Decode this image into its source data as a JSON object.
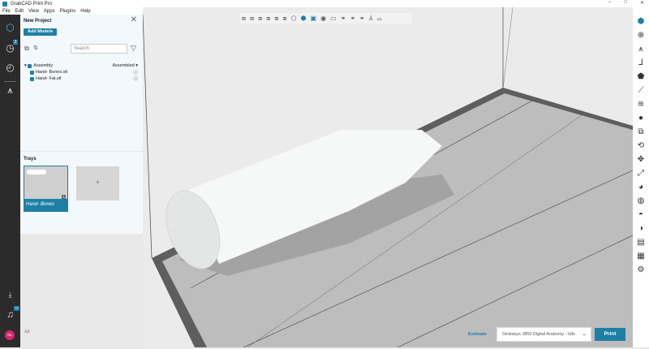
{
  "app": {
    "title": "GrabCAD Print Pro",
    "window_controls": [
      "–",
      "□",
      "✕"
    ]
  },
  "menu": [
    "File",
    "Edit",
    "View",
    "Apps",
    "Plugins",
    "Help"
  ],
  "leftbar": {
    "badge_recent": "2",
    "badge_notif": "9+",
    "avatar": "GL"
  },
  "panel": {
    "title": "New Project",
    "add_models": "Add Models",
    "search_placeholder": "Search",
    "tree": {
      "assembly": "Assembly",
      "mode": "Assembled",
      "items": [
        "Hand- Bones.stl",
        "Hand- Fat.stl"
      ]
    }
  },
  "trays": {
    "title": "Trays",
    "tray_name": "Hand- Bones",
    "count": "1"
  },
  "bottom": {
    "estimate": "Estimate",
    "printer": "Stratasys J850 Digital Anatomy - Idle",
    "print": "Print"
  },
  "colors": {
    "accent": "#1e7fa6",
    "sidebar": "#2b2b2b"
  }
}
